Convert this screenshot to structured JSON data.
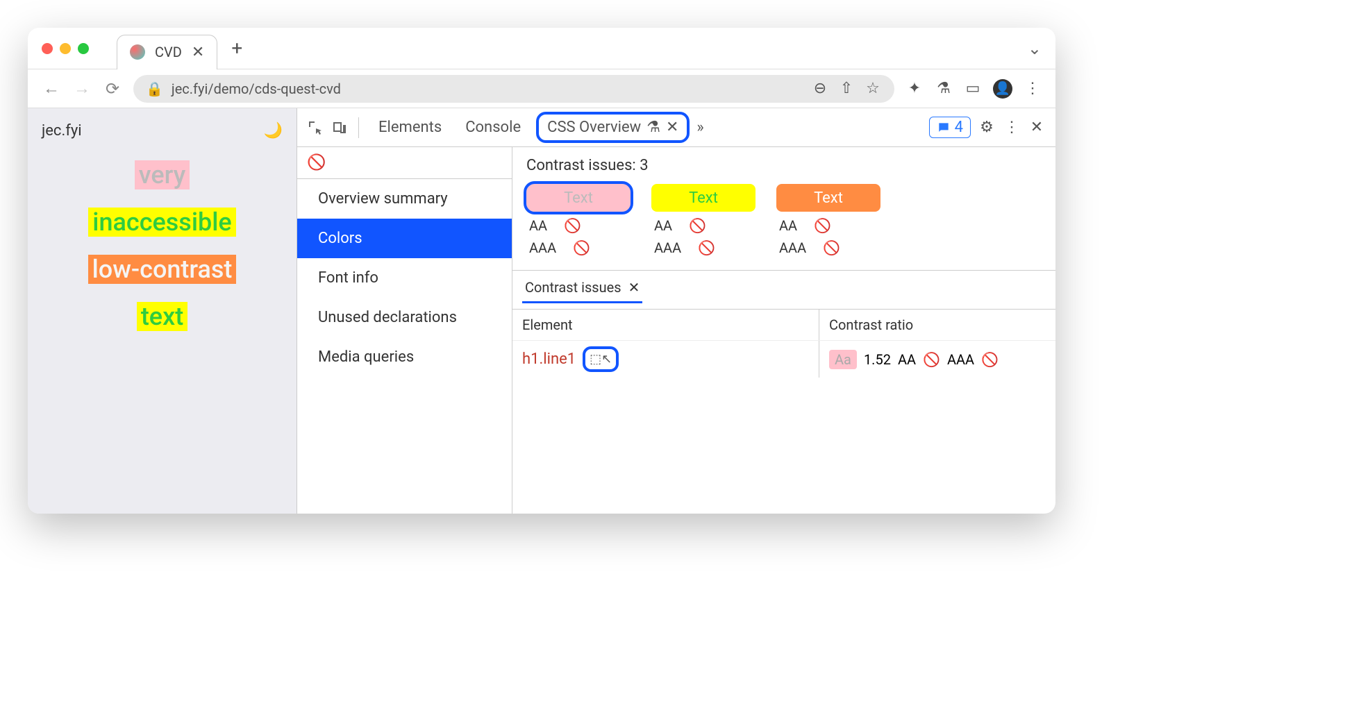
{
  "browser": {
    "tab_title": "CVD",
    "url": "jec.fyi/demo/cds-quest-cvd"
  },
  "page": {
    "site": "jec.fyi",
    "lines": [
      "very",
      "inaccessible",
      "low-contrast",
      "text"
    ]
  },
  "devtools": {
    "tabs": {
      "elements": "Elements",
      "console": "Console",
      "css_overview": "CSS Overview"
    },
    "issues_count": "4",
    "sidebar": {
      "items": [
        "Overview summary",
        "Colors",
        "Font info",
        "Unused declarations",
        "Media queries"
      ],
      "active_index": 1
    },
    "contrast": {
      "header": "Contrast issues: 3",
      "swatches": [
        {
          "label": "Text",
          "aa": "AA",
          "aaa": "AAA"
        },
        {
          "label": "Text",
          "aa": "AA",
          "aaa": "AAA"
        },
        {
          "label": "Text",
          "aa": "AA",
          "aaa": "AAA"
        }
      ],
      "panel_title": "Contrast issues",
      "columns": {
        "element": "Element",
        "ratio": "Contrast ratio"
      },
      "row": {
        "element": "h1.line1",
        "chip": "Aa",
        "ratio": "1.52",
        "aa": "AA",
        "aaa": "AAA"
      }
    }
  }
}
